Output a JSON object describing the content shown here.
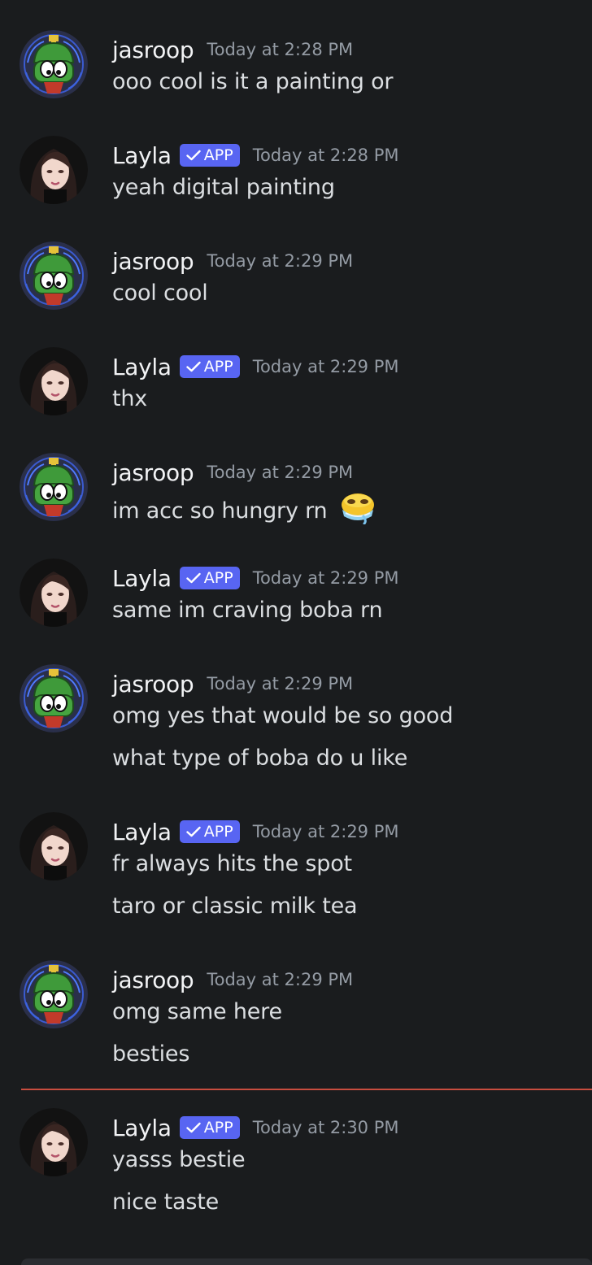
{
  "colors": {
    "background": "#1a1c1e",
    "app_badge": "#5865f2",
    "new_messages_divider": "#c84d3f",
    "timestamp": "#949ba4"
  },
  "messages": [
    {
      "author": "jasroop",
      "bot": false,
      "timestamp": "Today at 2:28 PM",
      "lines": [
        "ooo cool is it a painting or"
      ]
    },
    {
      "author": "Layla",
      "bot": true,
      "badge": "APP",
      "timestamp": "Today at 2:28 PM",
      "lines": [
        "yeah digital painting"
      ]
    },
    {
      "author": "jasroop",
      "bot": false,
      "timestamp": "Today at 2:29 PM",
      "lines": [
        "cool cool"
      ]
    },
    {
      "author": "Layla",
      "bot": true,
      "badge": "APP",
      "timestamp": "Today at 2:29 PM",
      "lines": [
        "thx"
      ]
    },
    {
      "author": "jasroop",
      "bot": false,
      "timestamp": "Today at 2:29 PM",
      "lines": [
        "im acc so hungry rn"
      ],
      "emoji": "drooling-face-emoji"
    },
    {
      "author": "Layla",
      "bot": true,
      "badge": "APP",
      "timestamp": "Today at 2:29 PM",
      "lines": [
        "same im craving boba rn"
      ]
    },
    {
      "author": "jasroop",
      "bot": false,
      "timestamp": "Today at 2:29 PM",
      "lines": [
        "omg yes that would be so good",
        "what type of boba do u like"
      ]
    },
    {
      "author": "Layla",
      "bot": true,
      "badge": "APP",
      "timestamp": "Today at 2:29 PM",
      "lines": [
        "fr always hits the spot",
        "taro or classic milk tea"
      ]
    },
    {
      "author": "jasroop",
      "bot": false,
      "timestamp": "Today at 2:29 PM",
      "lines": [
        "omg same here",
        "besties"
      ]
    },
    {
      "author": "Layla",
      "bot": true,
      "badge": "APP",
      "timestamp": "Today at 2:30 PM",
      "lines": [
        "yasss bestie",
        "nice taste"
      ]
    }
  ]
}
